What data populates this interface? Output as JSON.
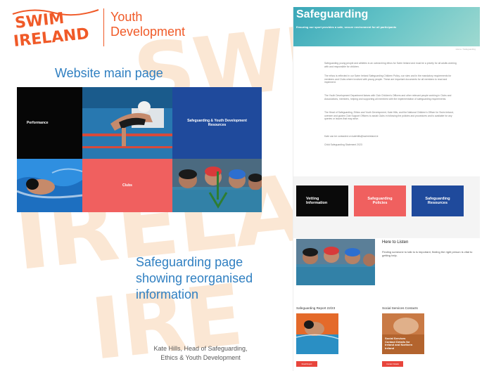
{
  "logo": {
    "line1": "SWIM",
    "line2": "IRELAND",
    "brand_color": "#f05a28"
  },
  "section_title": {
    "line1": "Youth",
    "line2": "Development"
  },
  "main_page_label": "Website main page",
  "tiles": {
    "performance": "Performance",
    "safeguarding_line1": "Safeguarding & Youth Development",
    "safeguarding_line2": "Resources",
    "clubs": "Clubs"
  },
  "caption": {
    "line1": "Safeguarding page",
    "line2": "showing reorganised",
    "line3": "information"
  },
  "byline": {
    "line1": "Kate Hills, Head of Safeguarding,",
    "line2": "Ethics & Youth Development"
  },
  "safeguarding_page": {
    "title": "Safeguarding",
    "subtitle": "Ensuring our sport provides a safe, secure environment for all participants",
    "breadcrumb": "Home / Safeguarding",
    "paragraphs": [
      "Safeguarding young people and athletes is an overarching ethos for Swim Ireland and must be a priority for all adults working with and responsible for children.",
      "The ethos is reflected in our Swim Ireland Safeguarding Children Policy, our rules and in the mandatory requirements for members and Clubs where involved with young people. These are important documents for all members to read and implement.",
      "The Youth Development Department liaises with Club Children's Officers and other relevant people working in Clubs and Associations, members, helping and supporting all members with the implementation of safeguarding requirements.",
      "The Head of Safeguarding, Ethics and Youth Development, Kate Hills, and the National Children's Officer for Swim Ireland, oversee and guides Club Support Officers to assist Clubs in following the policies and procedures and is available for any queries or issues that may arise.",
      "Kate can be contacted on katehills@swimireland.ie",
      "Child Safeguarding Statement 2023"
    ],
    "cards": [
      {
        "line1": "Vetting",
        "line2": "Information"
      },
      {
        "line1": "Safeguarding",
        "line2": "Policies"
      },
      {
        "line1": "Safeguarding",
        "line2": "Resources"
      }
    ],
    "listen_title": "Here to Listen",
    "listen_text": "Finding someone to talk to is important, finding the right person is vital to getting help.",
    "report_title": "Safeguarding Report 22/23",
    "report_button": "Read Report",
    "social_title": "Social Services Contacts",
    "social_thumb_label": "Social Services Contact Details for Ireland and Northern Ireland",
    "social_button": "Contact Details"
  }
}
